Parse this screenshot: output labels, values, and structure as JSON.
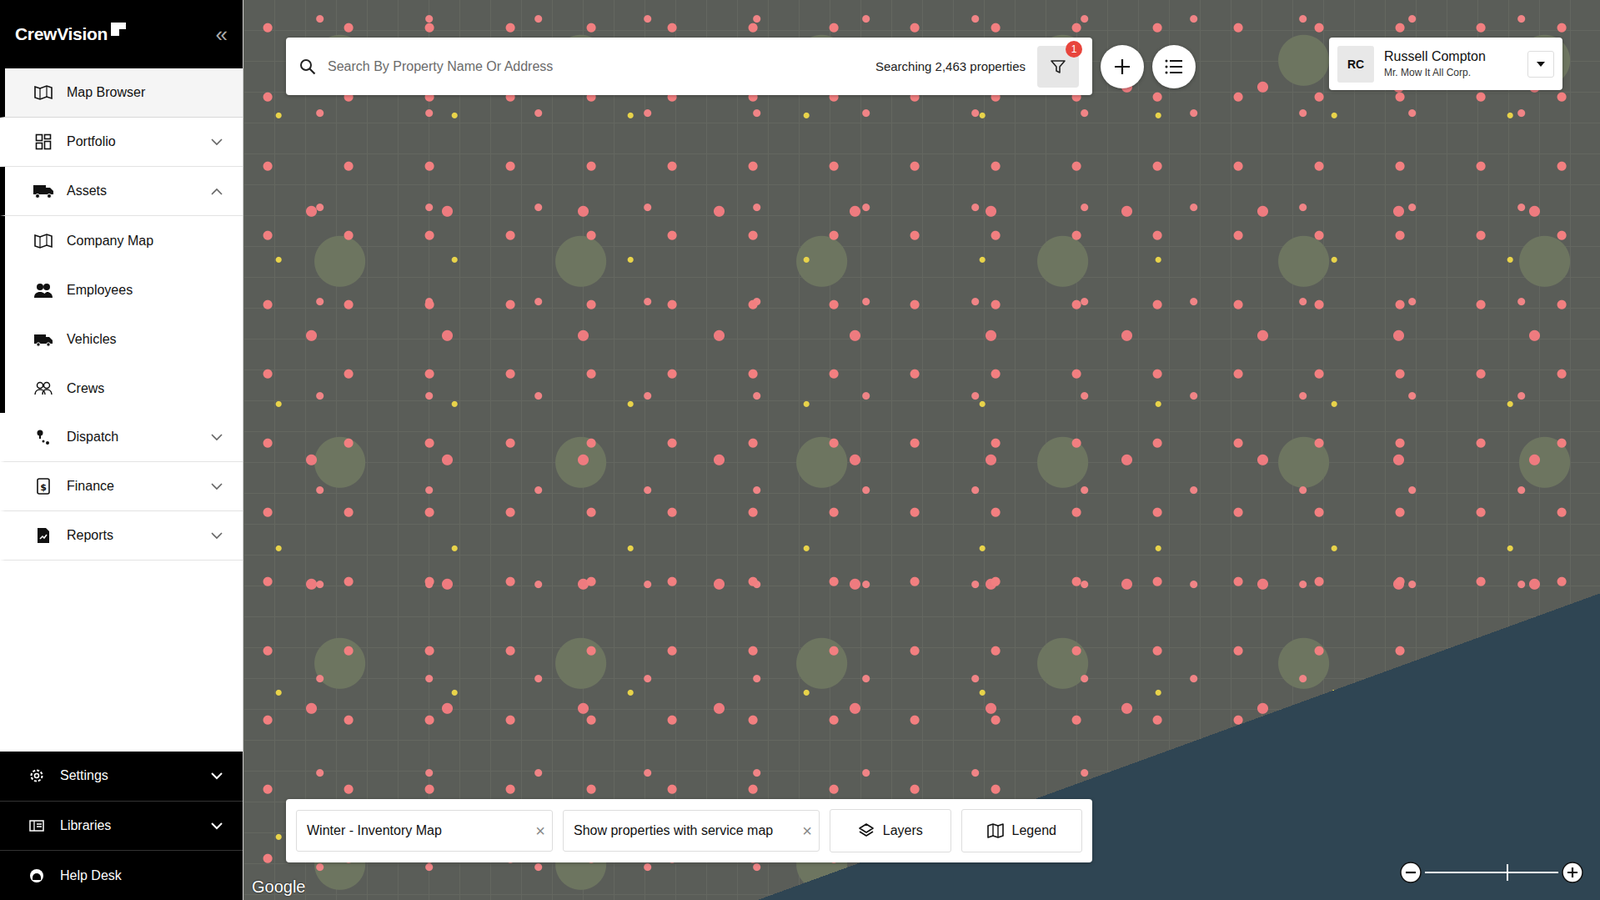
{
  "brand": {
    "logo": "CrewVision",
    "collapse": "«"
  },
  "sidebar": {
    "items": [
      {
        "label": "Map Browser",
        "kind": "link",
        "selected": true
      },
      {
        "label": "Portfolio",
        "kind": "group",
        "selected": false,
        "expanded": false
      },
      {
        "label": "Assets",
        "kind": "group",
        "selected": false,
        "expanded": true
      },
      {
        "label": "Company Map",
        "kind": "subitem",
        "selected": false
      },
      {
        "label": "Employees",
        "kind": "subitem",
        "selected": false
      },
      {
        "label": "Vehicles",
        "kind": "subitem",
        "selected": false
      },
      {
        "label": "Crews",
        "kind": "subitem",
        "selected": false
      },
      {
        "label": "Dispatch",
        "kind": "group",
        "selected": false,
        "expanded": false
      },
      {
        "label": "Finance",
        "kind": "group",
        "selected": false,
        "expanded": false
      },
      {
        "label": "Reports",
        "kind": "group",
        "selected": false,
        "expanded": false
      }
    ],
    "footer": [
      {
        "label": "Settings",
        "kind": "group",
        "expanded": false
      },
      {
        "label": "Libraries",
        "kind": "group",
        "expanded": false
      },
      {
        "label": "Help Desk",
        "kind": "link"
      }
    ]
  },
  "search": {
    "placeholder": "Search By Property Name Or Address",
    "count": "Searching 2,463 properties",
    "filter_badge": "1"
  },
  "user": {
    "initials": "RC",
    "name": "Russell Compton",
    "company": "Mr. Mow It All Corp."
  },
  "toolbar": {
    "map_select": {
      "value": "Winter - Inventory Map",
      "clear": "×"
    },
    "filter_select": {
      "value": "Show properties with service map",
      "clear": "×"
    },
    "buttons": [
      {
        "label": "Layers"
      },
      {
        "label": "Legend"
      }
    ]
  },
  "map": {
    "attribution": "Google",
    "zoom_level": 0.61
  }
}
